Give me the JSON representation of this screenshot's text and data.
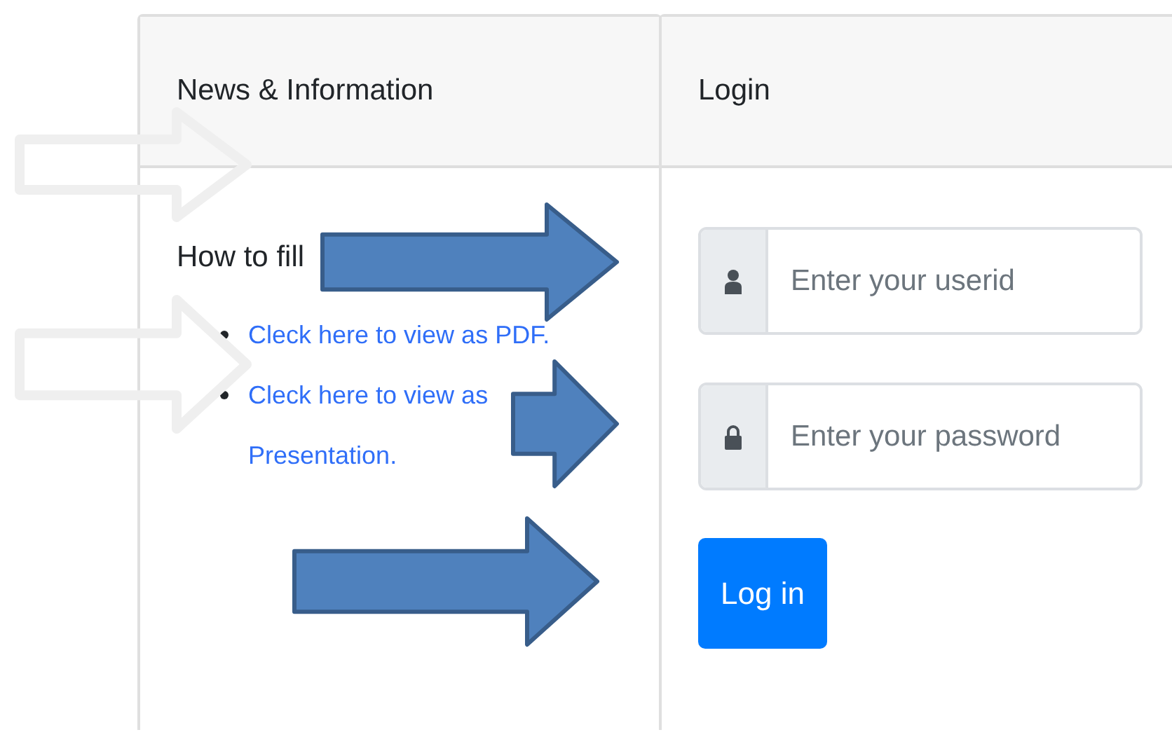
{
  "news_card": {
    "title": "News & Information",
    "heading": "How to fill",
    "links": [
      "Cleck here to view as PDF.",
      "Cleck here to view as Presentation."
    ]
  },
  "login_card": {
    "title": "Login",
    "fields": [
      {
        "kind": "user",
        "placeholder": "Enter your userid"
      },
      {
        "kind": "lock",
        "placeholder": "Enter your password"
      }
    ],
    "button": "Log in"
  },
  "annotations": [
    {
      "kind": "outline"
    },
    {
      "kind": "outline"
    },
    {
      "kind": "filled"
    },
    {
      "kind": "filled"
    },
    {
      "kind": "filled"
    }
  ]
}
